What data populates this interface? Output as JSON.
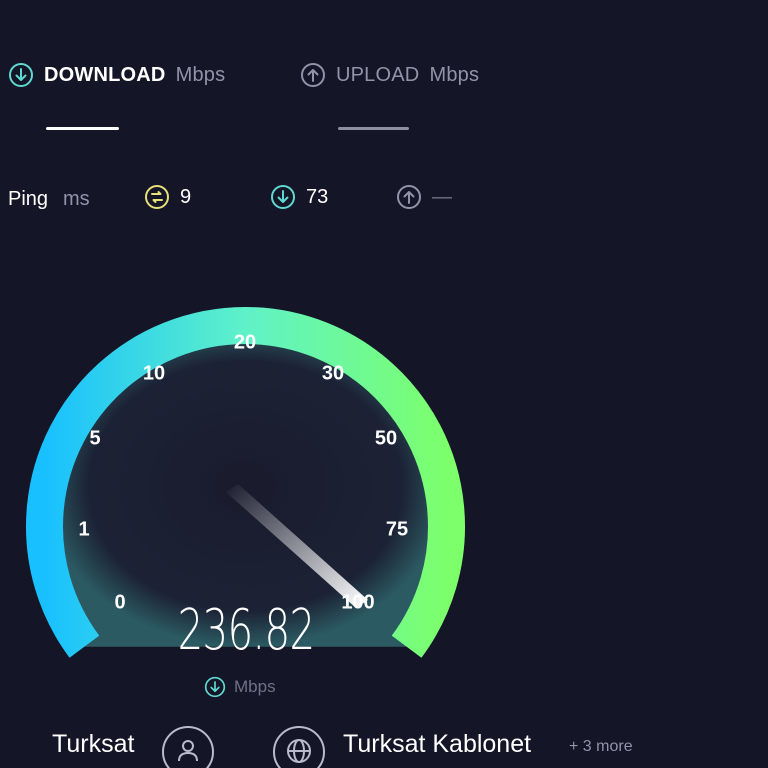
{
  "tabs": {
    "download": {
      "label": "DOWNLOAD",
      "unit": "Mbps",
      "active": true
    },
    "upload": {
      "label": "UPLOAD",
      "unit": "Mbps",
      "active": false
    }
  },
  "ping": {
    "label": "Ping",
    "unit": "ms",
    "idle": "9",
    "download": "73",
    "upload": "—"
  },
  "gauge": {
    "ticks": [
      "0",
      "1",
      "5",
      "10",
      "20",
      "30",
      "50",
      "75",
      "100"
    ],
    "value": "236.82",
    "unit": "Mbps"
  },
  "footer": {
    "isp": "Turksat",
    "server": "Turksat Kablonet",
    "more": "+ 3 more"
  },
  "colors": {
    "background": "#141526",
    "accent_cyan": "#5fd9d0",
    "accent_yellow": "#e8e07a",
    "gauge_start": "#18c0ff",
    "gauge_end": "#7cff6b"
  },
  "icons": {
    "download": "download-arrow-circle-icon",
    "upload": "upload-arrow-circle-icon",
    "idle_ping": "idle-ping-icon",
    "user": "user-icon",
    "globe": "globe-icon"
  }
}
